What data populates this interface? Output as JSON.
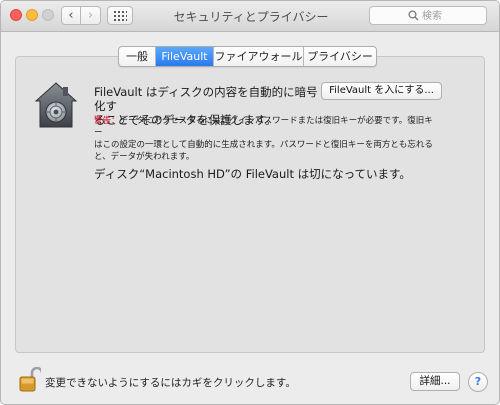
{
  "window": {
    "title": "セキュリティとプライバシー"
  },
  "toolbar": {
    "back_glyph": "‹",
    "forward_glyph": "›",
    "grid_icon": "grid-icon"
  },
  "search": {
    "placeholder": "検索",
    "icon": "search-icon"
  },
  "tabs": [
    {
      "label": "一般",
      "selected": false
    },
    {
      "label": "FileVault",
      "selected": true
    },
    {
      "label": "ファイアウォール",
      "selected": false
    },
    {
      "label": "プライバシー",
      "selected": false
    }
  ],
  "filevault": {
    "icon": "filevault-house-icon",
    "description_line1": "FileVault はディスクの内容を自動的に暗号化す",
    "description_line2": "ることでそのデータを保護します。",
    "turn_on_label": "FileVault を入にする...",
    "warning_label": "警告：",
    "warning_line1": "データにアクセスするにはログインパスワードまたは復旧キーが必要です。復旧キー",
    "warning_line2": "はこの設定の一環として自動的に生成されます。パスワードと復旧キーを両方とも忘れる",
    "warning_line3": "と、データが失われます。",
    "status": "ディスク“Macintosh HD”の FileVault は切になっています。"
  },
  "footer": {
    "lock_icon": "unlocked-padlock-icon",
    "lock_text": "変更できないようにするにはカギをクリックします。",
    "advanced_label": "詳細...",
    "help_label": "?"
  },
  "colors": {
    "accent": "#2a79ef",
    "warning": "#d0021b",
    "close": "#fc605c",
    "minimize": "#fdbc40"
  }
}
